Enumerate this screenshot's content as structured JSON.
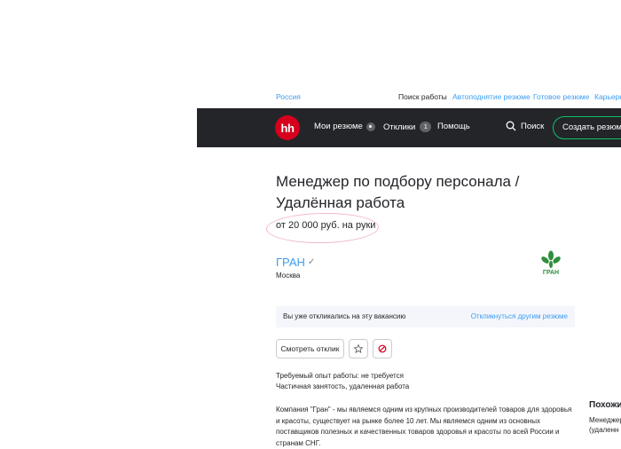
{
  "top_links": {
    "region": "Россия",
    "job_search": "Поиск работы",
    "auto_raise": "Автоподнятие резюме",
    "ready_resume": "Готовое резюме",
    "career": "Карьерн"
  },
  "header": {
    "logo": "hh",
    "my_resumes": "Мои резюме",
    "responses": "Отклики",
    "responses_count": "1",
    "help": "Помощь",
    "search": "Поиск",
    "create_resume": "Создать резюме"
  },
  "vacancy": {
    "title_line1": "Менеджер по подбору персонала /",
    "title_line2": "Удалённая работа",
    "salary": "от 20 000 руб. на руки"
  },
  "company": {
    "name": "ГРАН",
    "city": "Москва",
    "logo_text": "ГРАН"
  },
  "responded": {
    "text": "Вы уже откликались на эту вакансию",
    "link": "Откликнуться другим резюме"
  },
  "actions": {
    "view_response": "Смотреть отклик"
  },
  "requirements": {
    "experience": "Требуемый опыт работы: не требуется",
    "employment": "Частичная занятость, удаленная работа"
  },
  "description": "Компания \"Гран\" - мы являемся одним из крупных производителей товаров для здоровья и красоты, существует на рынке более 10 лет. Мы являемся одним из основных поставщиков полезных и качественных товаров здоровья и красоты по всей России и странам СНГ.",
  "sidebar": {
    "similar_title": "Похожи",
    "similar_lines": [
      "Менеджер",
      "(удаленн"
    ]
  },
  "colors": {
    "header_bg": "#232529",
    "brand_red": "#d6001c",
    "link_blue": "#3c9df2",
    "accent_green": "#0dc267"
  }
}
